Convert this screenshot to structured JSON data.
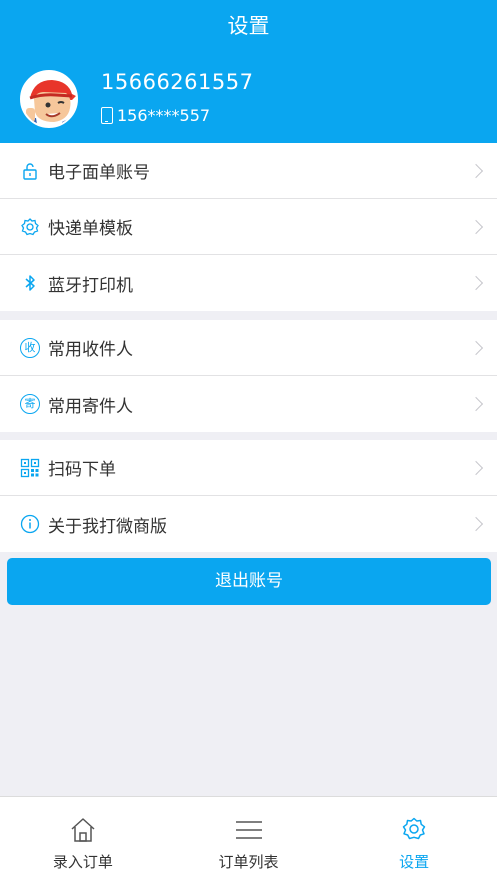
{
  "header": {
    "title": "设置",
    "phone": "15666261557",
    "masked_phone": "156****557"
  },
  "groups": [
    {
      "items": [
        {
          "label": "电子面单账号",
          "icon": "unlock-icon"
        },
        {
          "label": "快递单模板",
          "icon": "gear-icon"
        },
        {
          "label": "蓝牙打印机",
          "icon": "bluetooth-icon"
        }
      ]
    },
    {
      "items": [
        {
          "label": "常用收件人",
          "icon": "receive-icon",
          "icon_char": "收"
        },
        {
          "label": "常用寄件人",
          "icon": "send-icon",
          "icon_char": "寄"
        }
      ]
    },
    {
      "items": [
        {
          "label": "扫码下单",
          "icon": "qr-code-icon"
        },
        {
          "label": "关于我打微商版",
          "icon": "info-icon"
        }
      ]
    }
  ],
  "logout_label": "退出账号",
  "tabbar": {
    "tabs": [
      {
        "label": "录入订单",
        "icon": "home-icon",
        "active": false
      },
      {
        "label": "订单列表",
        "icon": "list-icon",
        "active": false
      },
      {
        "label": "设置",
        "icon": "gear-icon",
        "active": true
      }
    ]
  },
  "colors": {
    "accent": "#0aa6f0",
    "background": "#efeff4"
  }
}
